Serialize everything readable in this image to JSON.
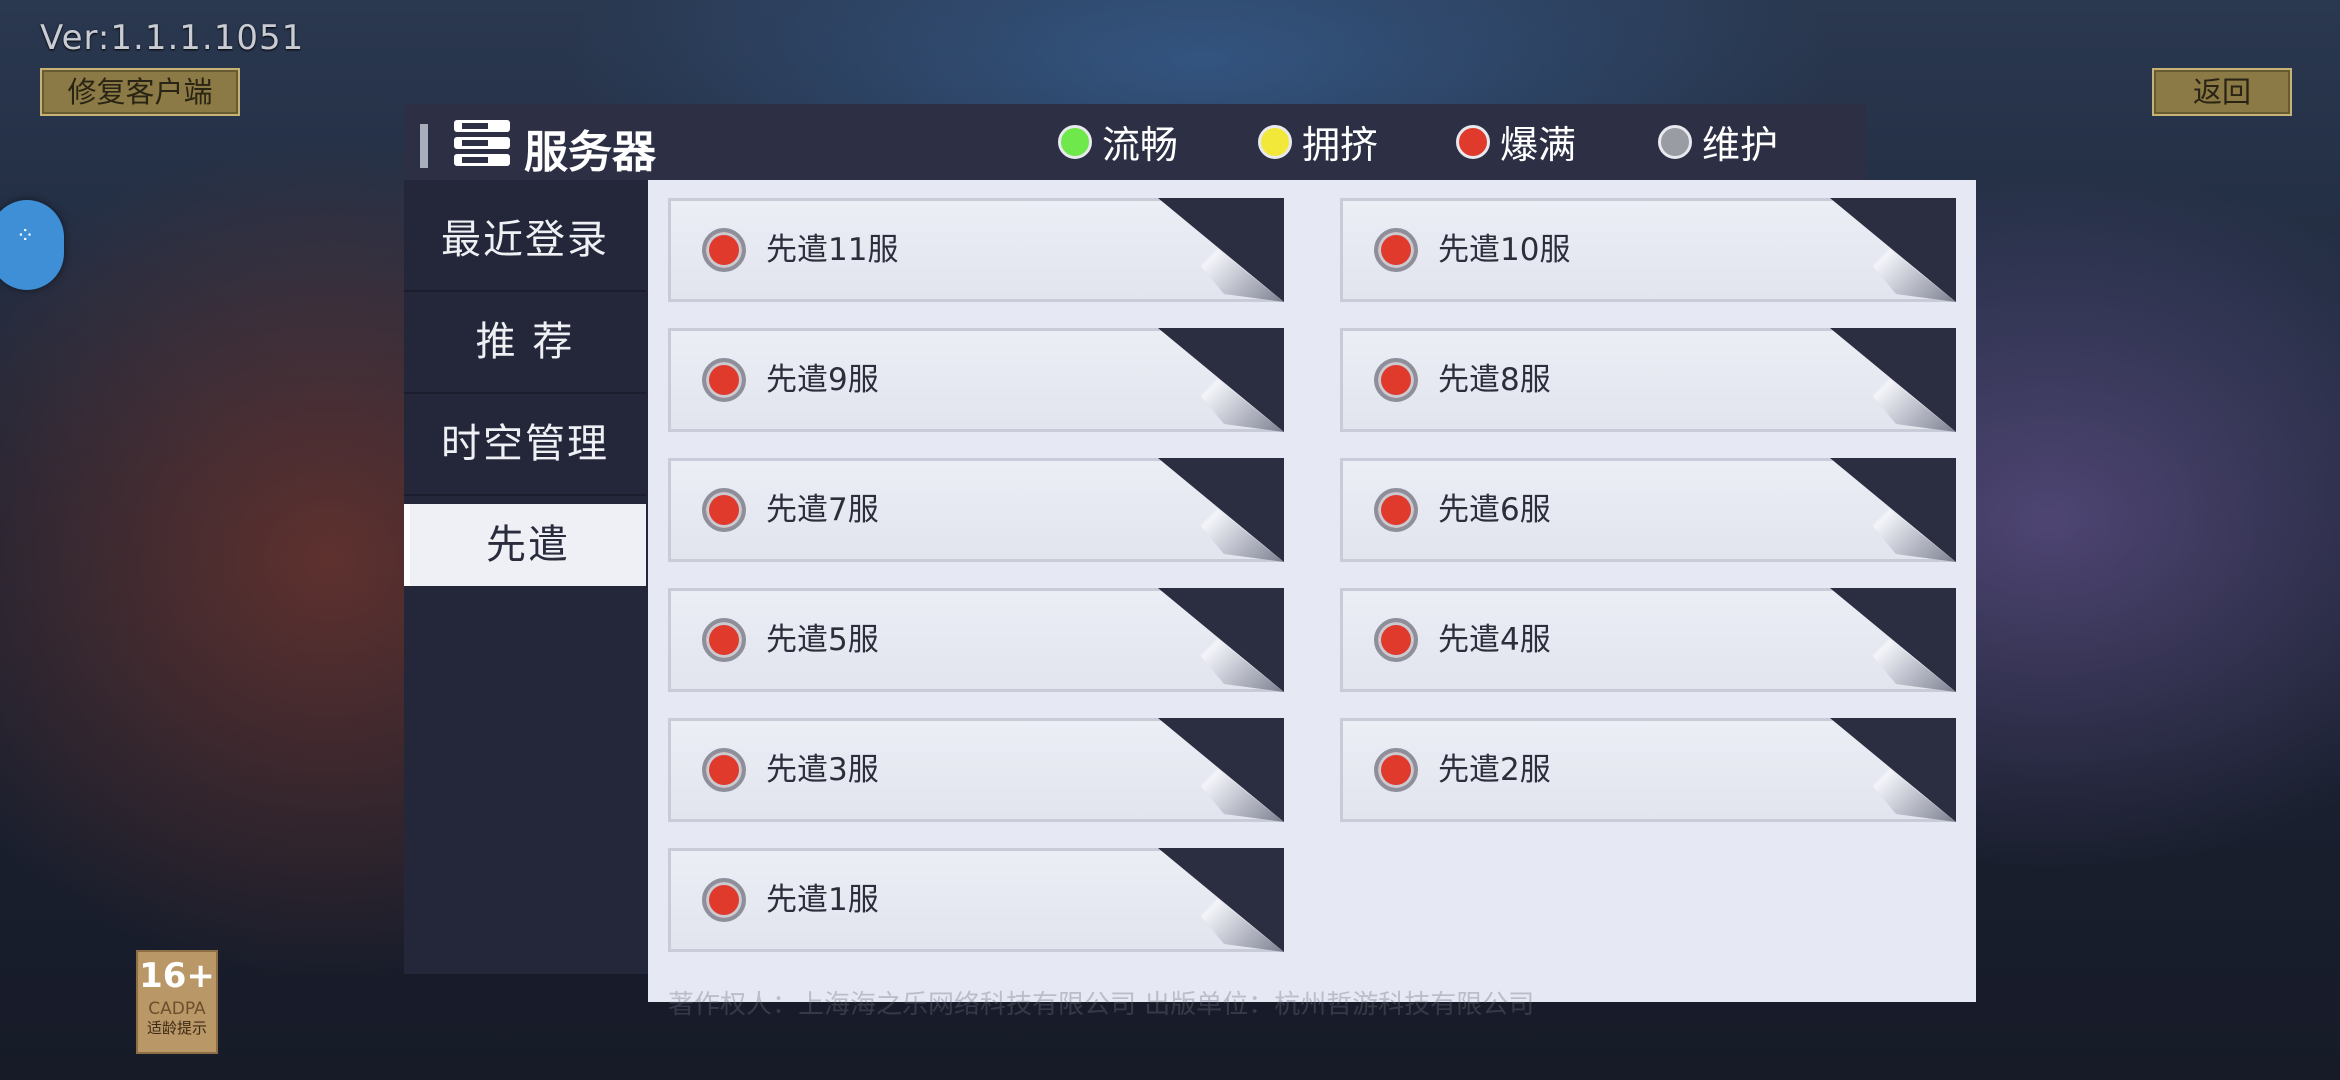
{
  "version": "Ver:1.1.1.1051",
  "repair_label": "修复客户端",
  "back_label": "返回",
  "title": "服务器",
  "legend": [
    {
      "label": "流畅",
      "color": "#6ee84a"
    },
    {
      "label": "拥挤",
      "color": "#f2e83a"
    },
    {
      "label": "爆满",
      "color": "#e03a2c"
    },
    {
      "label": "维护",
      "color": "#9a9ca4"
    }
  ],
  "sidebar": [
    {
      "label": "最近登录",
      "active": false
    },
    {
      "label": "推  荐",
      "active": false
    },
    {
      "label": "时空管理",
      "active": false
    },
    {
      "label": "先遣",
      "active": true
    }
  ],
  "servers": [
    {
      "name": "先遣11服",
      "status": "爆满"
    },
    {
      "name": "先遣10服",
      "status": "爆满"
    },
    {
      "name": "先遣9服",
      "status": "爆满"
    },
    {
      "name": "先遣8服",
      "status": "爆满"
    },
    {
      "name": "先遣7服",
      "status": "爆满"
    },
    {
      "name": "先遣6服",
      "status": "爆满"
    },
    {
      "name": "先遣5服",
      "status": "爆满"
    },
    {
      "name": "先遣4服",
      "status": "爆满"
    },
    {
      "name": "先遣3服",
      "status": "爆满"
    },
    {
      "name": "先遣2服",
      "status": "爆满"
    },
    {
      "name": "先遣1服",
      "status": "爆满"
    }
  ],
  "age_rating": {
    "number": "16+",
    "org": "CADPA",
    "note": "适龄提示"
  },
  "copyright": "著作权人：上海海之乐网络科技有限公司 出版单位：杭州哲游科技有限公司"
}
